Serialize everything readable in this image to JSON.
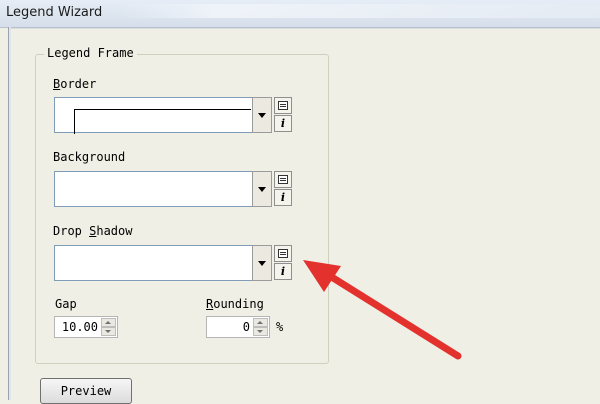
{
  "window": {
    "title": "Legend Wizard"
  },
  "legend_frame": {
    "group_label": "Legend Frame",
    "border": {
      "label_mnemonic": "B",
      "label_rest": "order"
    },
    "background": {
      "label": "Background"
    },
    "drop_shadow": {
      "label_pre": "Drop ",
      "label_mnemonic": "S",
      "label_rest": "hadow"
    },
    "gap": {
      "label": "Gap",
      "value": "10.00"
    },
    "rounding": {
      "label_mnemonic": "R",
      "label_rest": "ounding",
      "value": "0",
      "unit": "%"
    }
  },
  "buttons": {
    "preview": "Preview"
  },
  "icons": {
    "list": "list-icon",
    "info": "info-icon",
    "arrow": "red-arrow-annotation"
  },
  "colors": {
    "annotation_arrow": "#e3322d",
    "window_bg": "#f0efe5"
  }
}
